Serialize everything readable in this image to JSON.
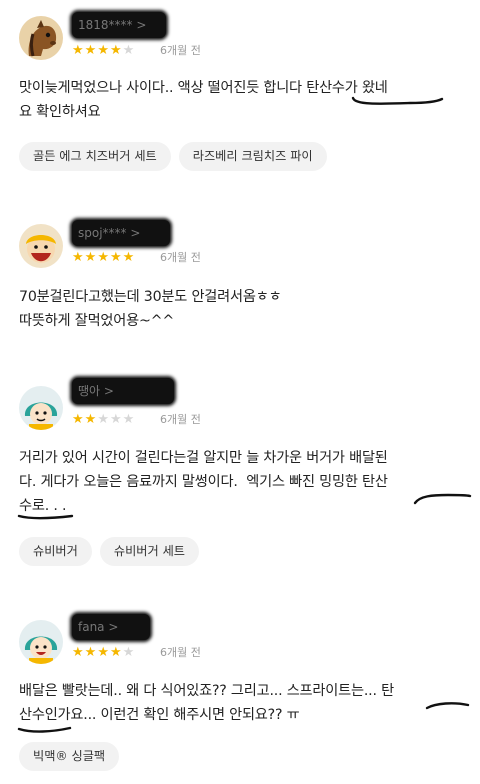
{
  "reviews": [
    {
      "user": "1818**** >",
      "rating": 4,
      "date": "6개월 전",
      "text": "맛이늦게먹었으나 사이다.. 액상 떨어진듯 합니다 탄산수가 왔네\n요 확인하셔요",
      "menus": [
        "골든 에그 치즈버거 세트",
        "라즈베리 크림치즈 파이"
      ]
    },
    {
      "user": "spoj**** >",
      "rating": 5,
      "date": "6개월 전",
      "text": "70분걸린다고했는데 30분도 안걸려서옴ㅎㅎ\n따뜻하게 잘먹었어용~^^",
      "menus": []
    },
    {
      "user": "땡아 >",
      "rating": 2,
      "date": "6개월 전",
      "text": "거리가 있어 시간이 걸린다는걸 알지만 늘 차가운 버거가 배달된\n다. 게다가 오늘은 음료까지 말썽이다.  엑기스 빠진 밍밍한 탄산\n수로. . .",
      "menus": [
        "슈비버거",
        "슈비버거 세트"
      ]
    },
    {
      "user": "fana >",
      "rating": 4,
      "date": "6개월 전",
      "text": "배달은 빨랏는데.. 왜 다 식어있죠?? 그리고... 스프라이트는... 탄\n산수인가요... 이런건 확인 해주시면 안되요?? ㅠ",
      "menus": [
        "빅맥® 싱글팩"
      ]
    }
  ],
  "colors": {
    "star_on": "#f5b700",
    "star_off": "#d7d7d7",
    "chip_bg": "#f2f2f2",
    "underline": "#111111"
  },
  "icons": [
    "horse-avatar-icon",
    "character-avatar-icon",
    "character-avatar-icon",
    "character-avatar-icon"
  ]
}
